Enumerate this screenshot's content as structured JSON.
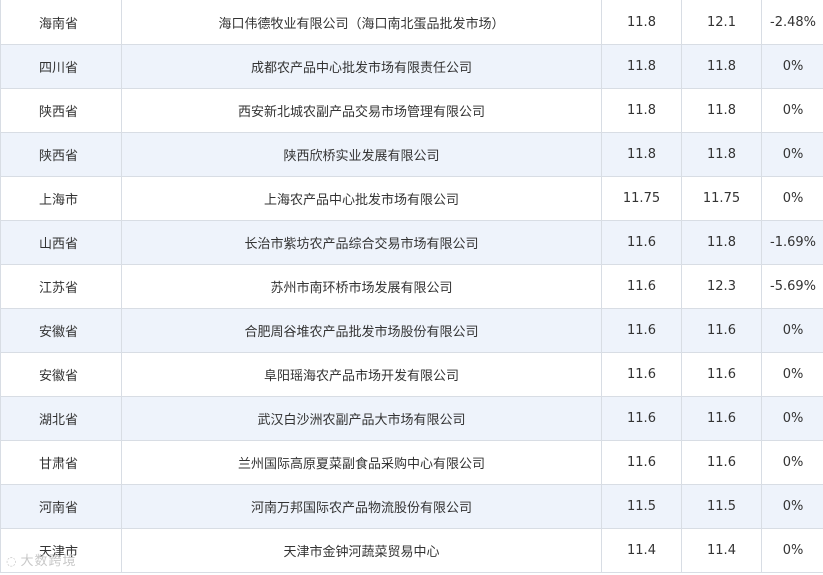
{
  "rows": [
    {
      "province": "海南省",
      "market": "海口伟德牧业有限公司（海口南北蛋品批发市场）",
      "today": "11.8",
      "yesterday": "12.1",
      "change": "-2.48%"
    },
    {
      "province": "四川省",
      "market": "成都农产品中心批发市场有限责任公司",
      "today": "11.8",
      "yesterday": "11.8",
      "change": "0%"
    },
    {
      "province": "陕西省",
      "market": "西安新北城农副产品交易市场管理有限公司",
      "today": "11.8",
      "yesterday": "11.8",
      "change": "0%"
    },
    {
      "province": "陕西省",
      "market": "陕西欣桥实业发展有限公司",
      "today": "11.8",
      "yesterday": "11.8",
      "change": "0%"
    },
    {
      "province": "上海市",
      "market": "上海农产品中心批发市场有限公司",
      "today": "11.75",
      "yesterday": "11.75",
      "change": "0%"
    },
    {
      "province": "山西省",
      "market": "长治市紫坊农产品综合交易市场有限公司",
      "today": "11.6",
      "yesterday": "11.8",
      "change": "-1.69%"
    },
    {
      "province": "江苏省",
      "market": "苏州市南环桥市场发展有限公司",
      "today": "11.6",
      "yesterday": "12.3",
      "change": "-5.69%"
    },
    {
      "province": "安徽省",
      "market": "合肥周谷堆农产品批发市场股份有限公司",
      "today": "11.6",
      "yesterday": "11.6",
      "change": "0%"
    },
    {
      "province": "安徽省",
      "market": "阜阳瑶海农产品市场开发有限公司",
      "today": "11.6",
      "yesterday": "11.6",
      "change": "0%"
    },
    {
      "province": "湖北省",
      "market": "武汉白沙洲农副产品大市场有限公司",
      "today": "11.6",
      "yesterday": "11.6",
      "change": "0%"
    },
    {
      "province": "甘肃省",
      "market": "兰州国际高原夏菜副食品采购中心有限公司",
      "today": "11.6",
      "yesterday": "11.6",
      "change": "0%"
    },
    {
      "province": "河南省",
      "market": "河南万邦国际农产品物流股份有限公司",
      "today": "11.5",
      "yesterday": "11.5",
      "change": "0%"
    },
    {
      "province": "天津市",
      "market": "天津市金钟河蔬菜贸易中心",
      "today": "11.4",
      "yesterday": "11.4",
      "change": "0%"
    }
  ],
  "watermark": {
    "text": "大数跨境",
    "icon": "camera-logo-icon"
  }
}
